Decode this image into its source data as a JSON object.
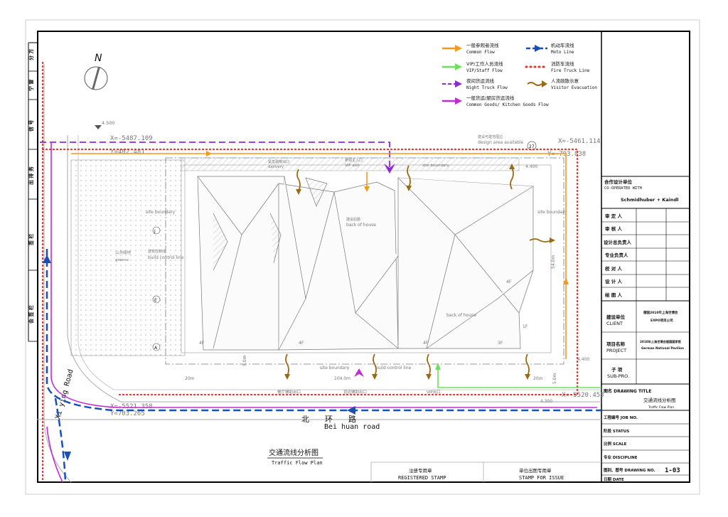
{
  "north_label": "N",
  "legend": [
    {
      "zh": "一般参观者流线",
      "en": "Common Flow",
      "color": "#f39a1e",
      "style": "solid-arrow"
    },
    {
      "zh": "机动车流线",
      "en": "Moto Line",
      "color": "#1a4fb5",
      "style": "dash-arrow"
    },
    {
      "zh": "VIP/工作人员流线",
      "en": "VIP/Staff Flow",
      "color": "#6fe05a",
      "style": "solid-arrow"
    },
    {
      "zh": "消防车流线",
      "en": "Fire Truck Line",
      "color": "#e8322e",
      "style": "dots"
    },
    {
      "zh": "夜间货运流线",
      "en": "Night Truck Flow",
      "color": "#8d2bd0",
      "style": "dash-hollow"
    },
    {
      "zh": "人流疏散示意",
      "en": "Visitor Evacuation",
      "color": "#9a6b14",
      "style": "wavy-arrow"
    },
    {
      "zh": "一般货运/厨房货运流线",
      "en": "Common Goods/ Kitchen Goods Flow",
      "color": "#c22ad8",
      "style": "solid-arrow"
    }
  ],
  "left_strip": [
    "分 方",
    "宁 雷",
    "信 号",
    "出 排 务",
    "签 栏",
    "会 签 栏"
  ],
  "plan_labels": {
    "level_tl": "4.500",
    "coord_tl_x": "X=-5487.109",
    "coord_tl_y": "Y=402.481",
    "coord_tr_x": "X=-5461.114",
    "coord_tr_y": "Y=-793.838",
    "design_area": "design area available",
    "design_area_zh": "建设可建范围边",
    "num_27": "27",
    "level_tr": "4.400",
    "emergency": "紧急疏散出口",
    "delivery": "delivery",
    "vip_entrance": "参观主入口",
    "vip_entrance_en": "VIP exit",
    "site_boundary_top": "site boundary",
    "back_of_house_1": "back of house",
    "back_of_house_2": "back of house",
    "site_boundary_left": "site boundary",
    "boh_zh": "建设后勤",
    "public_green": "公共绿地",
    "green": "greenz",
    "build_control": "build control line",
    "build_control_zh": "建筑控制线",
    "site_boundary_right": "site boundary",
    "grid_j": "J",
    "grid_e": "E",
    "grid_a": "A",
    "floor_4f_left": "4F",
    "floor_4f_mid": "4F",
    "floor_3f": "3F",
    "floor_1f": "1F",
    "floor_4f_right": "4F",
    "dim_20_left": "20m",
    "dim_20_right": "20m",
    "dim_104": "104.0m",
    "dim_5_left": "5.0m",
    "dim_5_right": "5.0m",
    "dim_54": "54.0m",
    "site_boundary_bottom": "site boundary",
    "build_control_bottom": "build control line",
    "bottom_entrance_1": "餐厅辅助出口",
    "bottom_entrance_2": "货运辅助出口",
    "bottom_entrance_3": "VIP出口",
    "coord_br_x": "X=-5520.458",
    "coord_bl_x": "X=-5521.358",
    "coord_bl_y": "Y=703.265",
    "level_br": "4.300",
    "level_right": "4.400",
    "road_bottom_zh": "北　　环　　路",
    "road_bottom_en": "Bei huan road",
    "road_left_en": "Xi ying Road"
  },
  "plan_title_zh": "交通流线分析图",
  "plan_title_en": "Traffic Flow Plan",
  "stamps": {
    "registered_zh": "注册专用章",
    "registered_en": "REGISTERED STAMP",
    "issue_zh": "单位出图专用章",
    "issue_en": "STAMP FOR ISSUE"
  },
  "title_block": {
    "cooperated_zh": "合作设计单位",
    "cooperated_en": "CO-OPERATED WITH",
    "firm": "Schmidhuber + Kaindl",
    "roles": [
      "审 定 人",
      "审 核 人",
      "设计总负责人",
      "专业负责人",
      "校 对 人",
      "设 计 人",
      "绘 图 人"
    ],
    "client_zh": "建设单位",
    "client_en": "CLIENT",
    "client_value_1": "德国2010年上海世博会",
    "client_value_2": "EXPO项目公司",
    "project_zh": "项目名称",
    "project_en": "PROJECT",
    "project_value_1": "2010年上海世博会德国国家馆",
    "project_value_2": "German National Pavilion",
    "sub_zh": "子 项",
    "sub_en": "SUB-PRO.",
    "drawing_title_label": "图名 DRAWING TITLE",
    "drawing_title_zh": "交通流线分析图",
    "drawing_title_en": "Traffic Flow Plan",
    "job_no": "工程编号 JOB NO.",
    "status": "阶段 STATUS",
    "scale": "比例 SCALE",
    "discipline": "专业 DISCIPLINE",
    "drawing_no_label": "图别、图号 DRAWING NO.",
    "drawing_no": "1-03",
    "date": "日期 DATE"
  }
}
